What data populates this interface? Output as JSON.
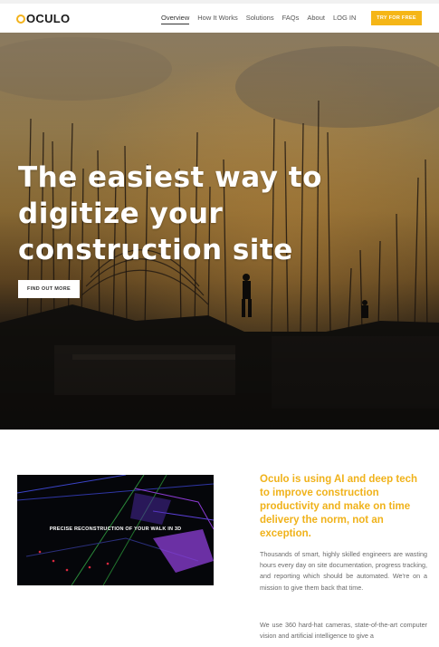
{
  "nav": {
    "logo": "OCULO",
    "links": [
      "Overview",
      "How It Works",
      "Solutions",
      "FAQs",
      "About",
      "LOG IN"
    ],
    "cta": "TRY FOR FREE"
  },
  "hero": {
    "title": "The easiest way to digitize your construction site",
    "button": "FIND OUT MORE"
  },
  "media": {
    "caption": "PRECISE RECONSTRUCTION OF YOUR WALK IN 3D"
  },
  "content": {
    "headline": "Oculo is using AI and deep tech to improve construction productivity and make on time delivery the norm, not an exception.",
    "paragraph1": "Thousands of smart, highly skilled engineers are wasting hours every day on site documentation, progress tracking, and reporting which should be automated. We're on a mission to give them back that time.",
    "paragraph2": "We use 360 hard-hat cameras, state-of-the-art computer vision and artificial intelligence to give a"
  },
  "colors": {
    "accent": "#f5b617",
    "headline": "#f0b21a"
  }
}
